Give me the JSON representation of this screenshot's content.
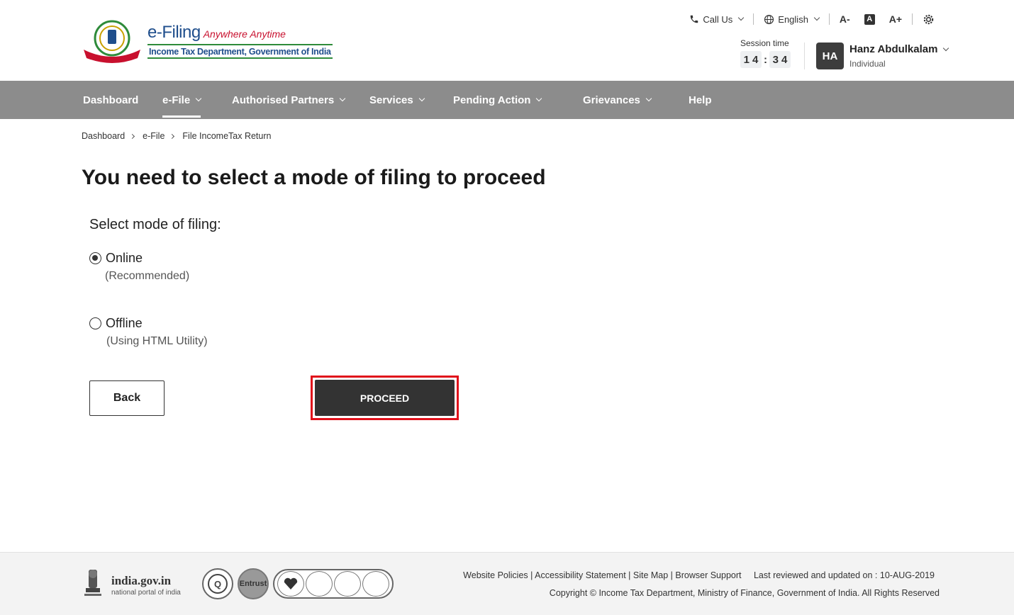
{
  "header": {
    "brand_title": "e-Filing",
    "brand_tagline": "Anywhere Anytime",
    "brand_subtitle": "Income Tax Department, Government of India",
    "emblem_caption": "INCOME TAX DEPARTMENT",
    "call_us": "Call Us",
    "language": "English",
    "font_decrease": "A-",
    "font_reset": "A",
    "font_increase": "A+",
    "session_label": "Session time",
    "session_minutes": "14",
    "session_seconds": "34",
    "user_initials": "HA",
    "user_name": "Hanz Abdulkalam",
    "user_role": "Individual"
  },
  "nav": {
    "items": [
      {
        "label": "Dashboard"
      },
      {
        "label": "e-File"
      },
      {
        "label": "Authorised Partners"
      },
      {
        "label": "Services"
      },
      {
        "label": "Pending Action"
      },
      {
        "label": "Grievances"
      },
      {
        "label": "Help"
      }
    ]
  },
  "breadcrumb": [
    "Dashboard",
    "e-File",
    "File IncomeTax Return"
  ],
  "main": {
    "title": "You need to select a mode of filing to proceed",
    "mode_label": "Select mode of filing:",
    "options": [
      {
        "label": "Online",
        "sub": "(Recommended)",
        "checked": true
      },
      {
        "label": "Offline",
        "sub": "(Using HTML Utility)",
        "checked": false
      }
    ],
    "back_label": "Back",
    "proceed_label": "PROCEED"
  },
  "footer": {
    "india_gov": "india.gov.in",
    "india_sub": "national portal of india",
    "badge_entrust": "Entrust",
    "links": "Website Policies | Accessibility Statement | Site Map | Browser Support",
    "reviewed": "Last reviewed and updated on : 10-AUG-2019",
    "copyright": "Copyright © Income Tax Department, Ministry of Finance, Government of India. All Rights Reserved"
  },
  "colors": {
    "nav_bg": "#8c8c8c",
    "primary_button": "#333333",
    "highlight_outline": "#e0101a",
    "brand_blue": "#1f4e8c"
  }
}
